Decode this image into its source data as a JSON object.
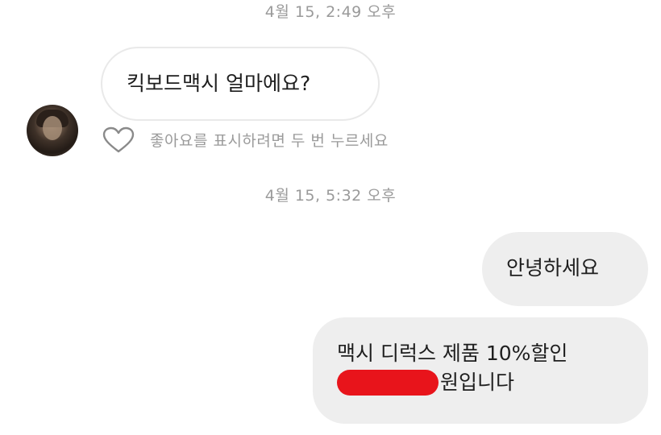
{
  "messages": {
    "timestamp_1": "4월 15, 2:49 오후",
    "incoming_text": "킥보드맥시 얼마에요?",
    "like_hint": "좋아요를 표시하려면 두 번 누르세요",
    "timestamp_2": "4월 15, 5:32 오후",
    "outgoing_1_text": "안녕하세요",
    "outgoing_2_line1": "맥시 디럭스 제품 10%할인",
    "outgoing_2_line2_suffix": "원입니다"
  },
  "icons": {
    "like": "heart-outline-icon",
    "redaction": "red-redaction-mark"
  },
  "colors": {
    "timestamp": "#9a9a9a",
    "outgoing_bubble": "#eeeeee",
    "incoming_border": "#e9e9e9",
    "redaction": "#e8141b"
  }
}
